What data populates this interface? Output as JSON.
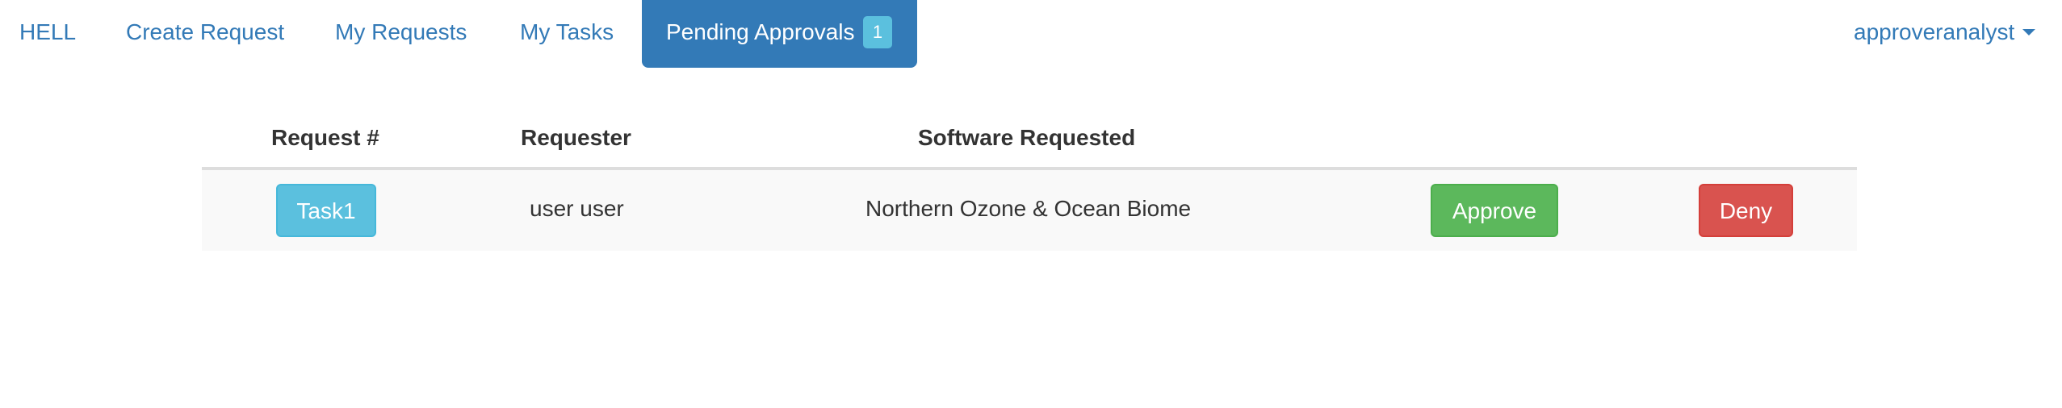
{
  "nav": {
    "brand": "HELL",
    "create_request": "Create Request",
    "my_requests": "My Requests",
    "my_tasks": "My Tasks",
    "pending_approvals": "Pending Approvals",
    "pending_count": "1",
    "user": "approveranalyst",
    "user_icon": "caret-down-icon"
  },
  "table": {
    "headers": {
      "request_num": "Request #",
      "requester": "Requester",
      "software": "Software Requested"
    },
    "rows": [
      {
        "task": "Task1",
        "requester": "user user",
        "software": "Northern Ozone & Ocean Biome",
        "approve": "Approve",
        "deny": "Deny"
      }
    ]
  },
  "colors": {
    "primary": "#337ab7",
    "info": "#5bc0de",
    "success": "#5cb85c",
    "danger": "#d9534f"
  }
}
